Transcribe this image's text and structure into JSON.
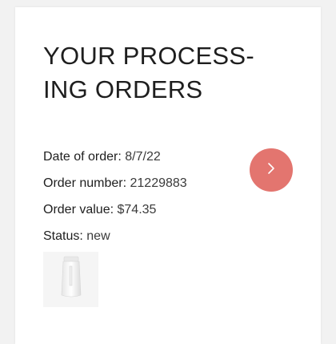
{
  "section": {
    "title": "YOUR PROCESS-\nING ORDERS"
  },
  "order": {
    "date_label": "Date of order:",
    "date_value": "8/7/22",
    "number_label": "Order number:",
    "number_value": "21229883",
    "value_label": "Order value:",
    "value_value": "$74.35",
    "status_label": "Status:",
    "status_value": "new"
  },
  "actions": {
    "open_order_icon": "chevron-right-icon"
  },
  "product_thumbnail": {
    "icon": "product-tube-icon"
  },
  "colors": {
    "accent": "#e3756f",
    "text": "#1e1e1e",
    "card_bg": "#ffffff",
    "page_bg": "#f2f2f2"
  }
}
